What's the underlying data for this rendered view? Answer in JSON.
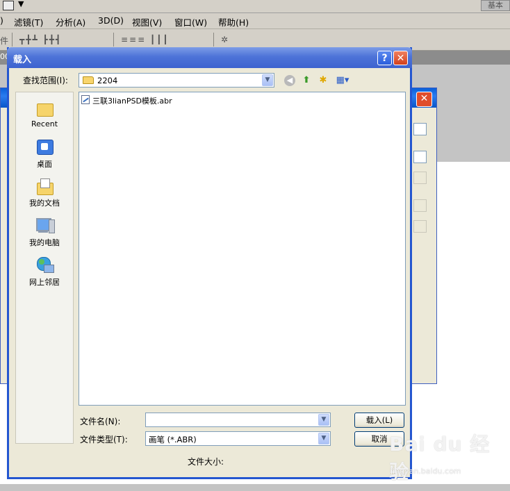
{
  "ps": {
    "workspace_label": "基本",
    "menus": [
      "滤镜(T)",
      "分析(A)",
      "3D(D)",
      "视图(V)",
      "窗口(W)",
      "帮助(H)"
    ],
    "left_fragment": ")",
    "optbar_fragment": "件",
    "strip_fragment": "00"
  },
  "dialog": {
    "title": "载入",
    "help_glyph": "?",
    "close_glyph": "✕",
    "look_in_label": "查找范围(I):",
    "look_in_value": "2204",
    "places": [
      {
        "label": "Recent",
        "icon": "recent-folder-icon"
      },
      {
        "label": "桌面",
        "icon": "desktop-icon"
      },
      {
        "label": "我的文档",
        "icon": "my-documents-icon"
      },
      {
        "label": "我的电脑",
        "icon": "my-computer-icon"
      },
      {
        "label": "网上邻居",
        "icon": "network-places-icon"
      }
    ],
    "files": [
      {
        "name": "三联3lianPSD模板.abr",
        "icon": "brush-file-icon"
      }
    ],
    "filename_label": "文件名(N):",
    "filename_value": "",
    "filetype_label": "文件类型(T):",
    "filetype_value": "画笔 (*.ABR)",
    "load_button": "载入(L)",
    "cancel_button": "取消",
    "file_size_label": "文件大小:"
  },
  "watermark": {
    "brand": "Bai du 经验",
    "url": "jingyan.baidu.com"
  }
}
